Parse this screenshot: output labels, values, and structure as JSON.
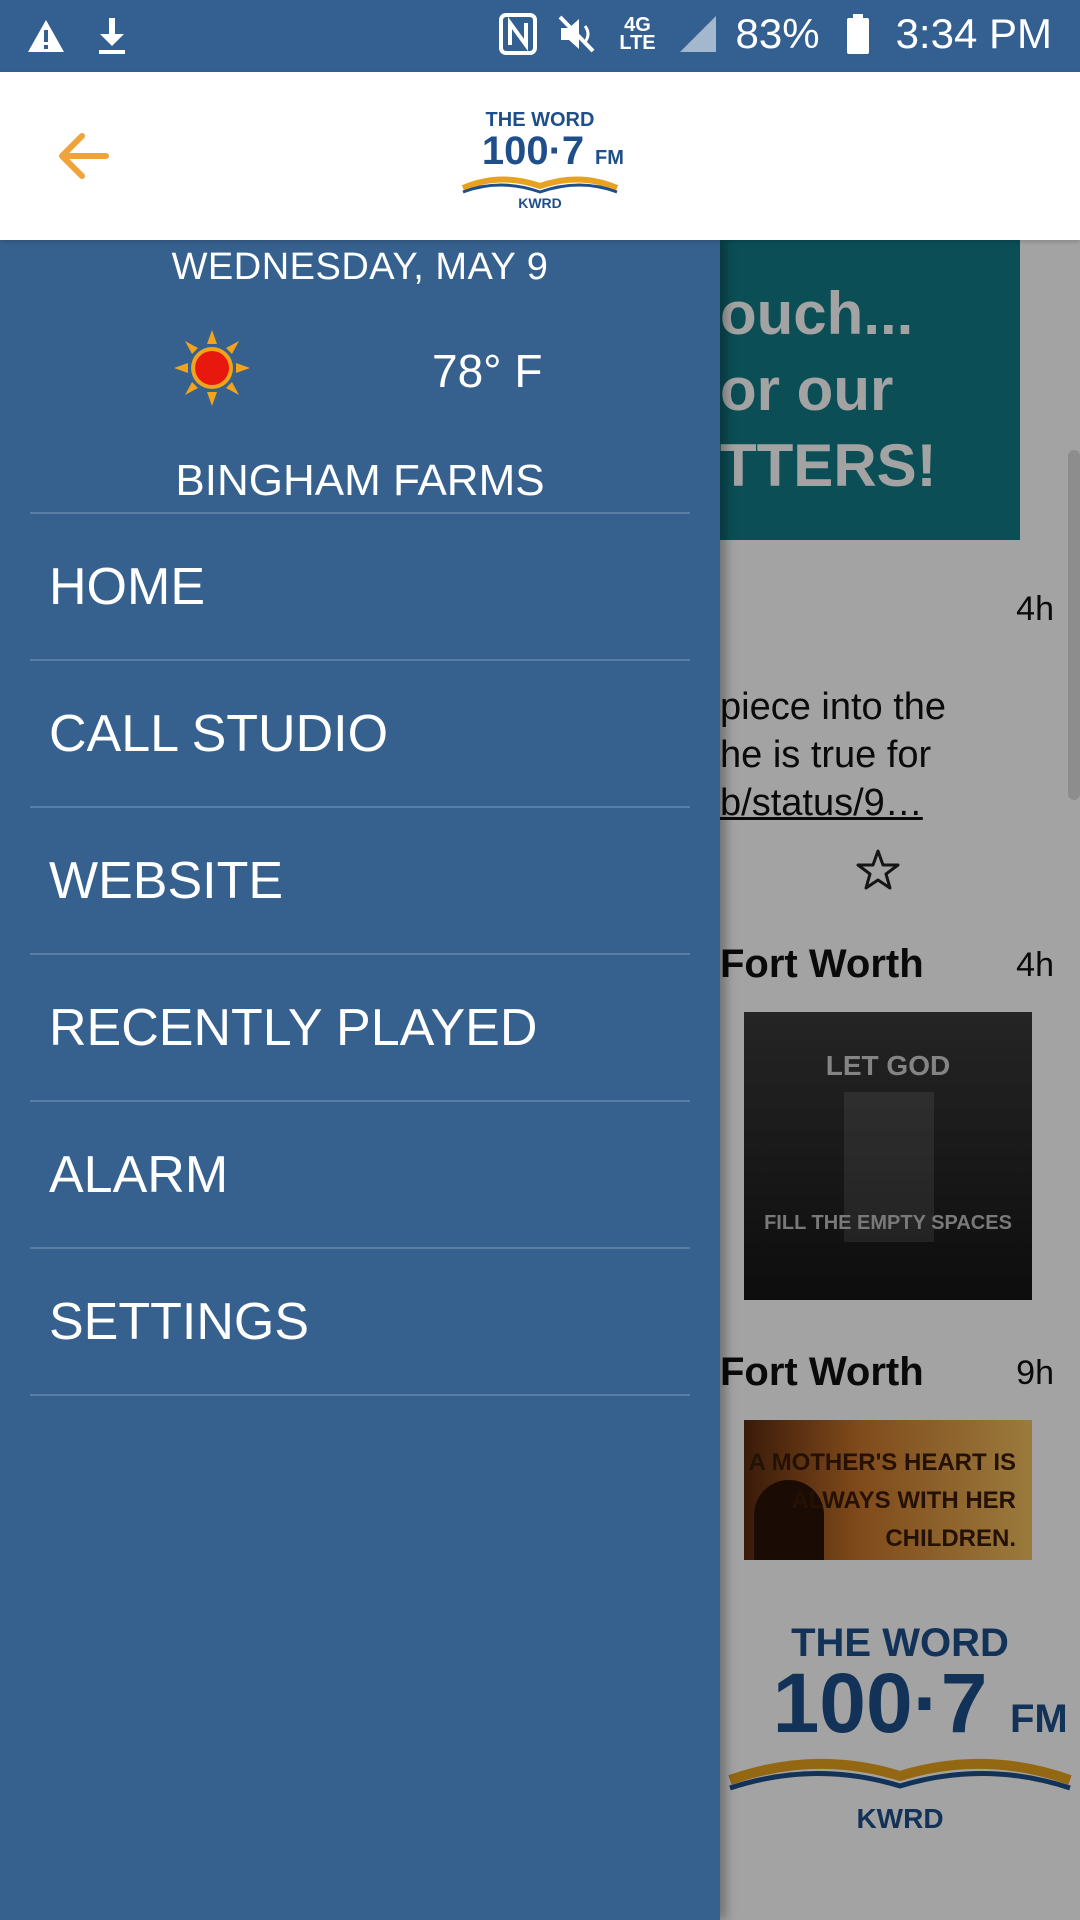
{
  "status_bar": {
    "battery": "83%",
    "time": "3:34 PM",
    "network": "4G LTE",
    "icons": [
      "warning-icon",
      "download-icon",
      "nfc-icon",
      "mute-icon",
      "signal-icon",
      "battery-icon"
    ]
  },
  "app_bar": {
    "back_icon": "arrow-left-icon",
    "logo": {
      "line1": "THE WORD",
      "line2": "100·7",
      "line2_unit": "FM",
      "line3": "KWRD"
    }
  },
  "drawer": {
    "date": "WEDNESDAY, MAY 9",
    "weather_icon": "sun-icon",
    "temperature": "78° F",
    "city": "BINGHAM FARMS",
    "menu": [
      {
        "label": "HOME"
      },
      {
        "label": "CALL STUDIO"
      },
      {
        "label": "WEBSITE"
      },
      {
        "label": "RECENTLY PLAYED"
      },
      {
        "label": "ALARM"
      },
      {
        "label": "SETTINGS"
      }
    ]
  },
  "feed": {
    "banner_lines": [
      "ouch...",
      "or our",
      "TTERS!"
    ],
    "post1_time": "4h",
    "post1_lines": [
      "piece into the",
      "he is true for",
      "b/status/9…"
    ],
    "post2_author": "Fort Worth",
    "post2_time": "4h",
    "post2_image_top": "LET GOD",
    "post2_image_bottom": "FILL THE EMPTY SPACES",
    "post3_author": "Fort Worth",
    "post3_time": "9h",
    "post3_image_lines": [
      "A MOTHER'S HEART IS",
      "ALWAYS WITH HER",
      "CHILDREN."
    ],
    "footer_logo": {
      "line1": "THE WORD",
      "line2": "100·7",
      "line2_unit": "FM",
      "line3": "KWRD"
    }
  },
  "colors": {
    "primary": "#36618f",
    "status_bar": "#345f91",
    "accent": "#f0a33a",
    "teal": "#127a86"
  }
}
